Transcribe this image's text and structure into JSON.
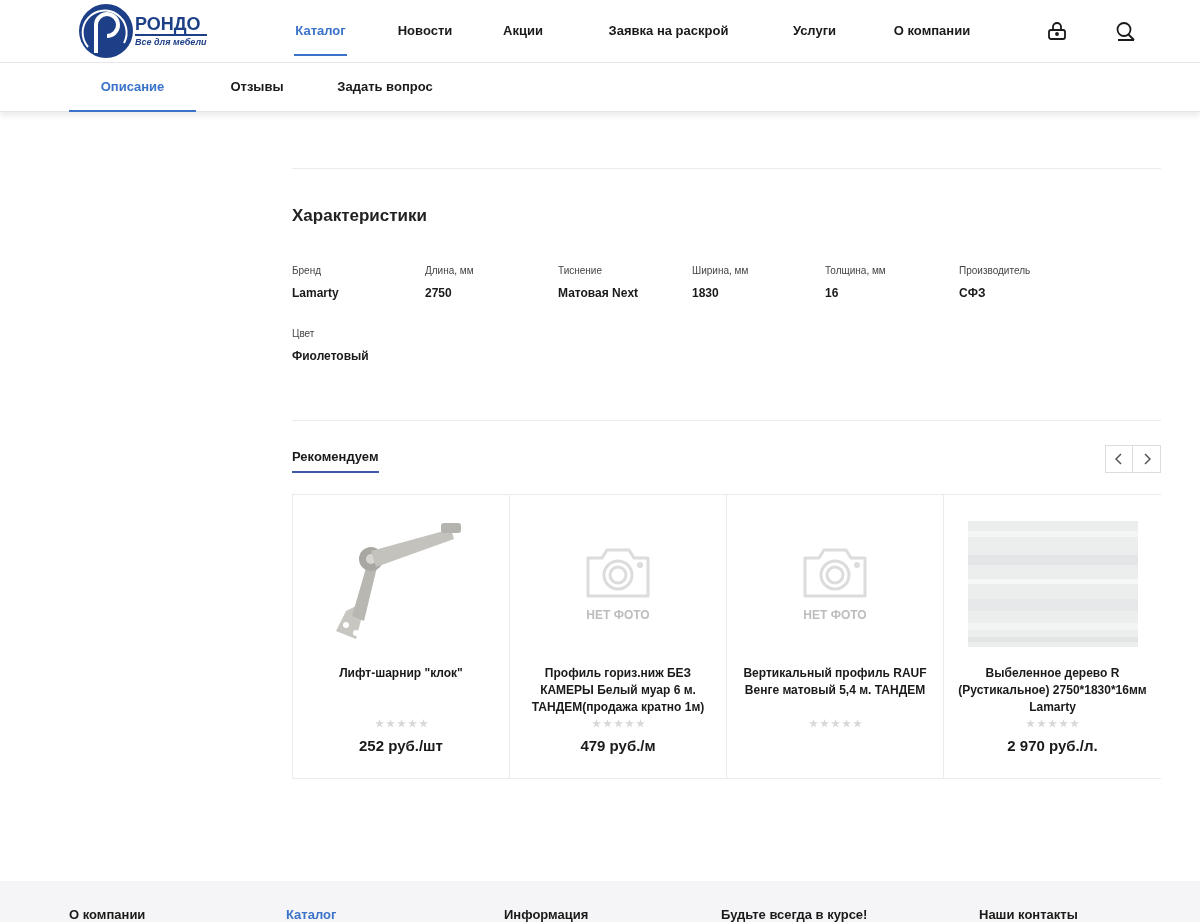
{
  "logo": {
    "name": "РОНДО",
    "tagline": "Все для мебели"
  },
  "nav": [
    {
      "label": "Каталог",
      "selected": true
    },
    {
      "label": "Новости",
      "selected": false
    },
    {
      "label": "Акции",
      "selected": false
    },
    {
      "label": "Заявка на раскрой",
      "selected": false
    },
    {
      "label": "Услуги",
      "selected": false
    },
    {
      "label": "О компании",
      "selected": false
    }
  ],
  "tabs": [
    {
      "label": "Описание",
      "selected": true
    },
    {
      "label": "Отзывы",
      "selected": false
    },
    {
      "label": "Задать вопрос",
      "selected": false
    }
  ],
  "specs": {
    "title": "Характеристики",
    "items": [
      {
        "label": "Бренд",
        "value": "Lamarty"
      },
      {
        "label": "Длина, мм",
        "value": "2750"
      },
      {
        "label": "Тиснение",
        "value": "Матовая Next"
      },
      {
        "label": "Ширина, мм",
        "value": "1830"
      },
      {
        "label": "Толщина, мм",
        "value": "16"
      },
      {
        "label": "Производитель",
        "value": "СФЗ"
      },
      {
        "label": "Цвет",
        "value": "Фиолетовый"
      }
    ]
  },
  "recommend": {
    "title": "Рекомендуем",
    "products": [
      {
        "name": "Лифт-шарнир \"клок\"",
        "stars": 0,
        "price": "252 руб./шт"
      },
      {
        "image": {
          "kind": "no_photo",
          "text": "НЕТ ФОТО"
        },
        "name": "Профиль гориз.ниж БЕЗ КАМЕРЫ Белый муар 6 м. ТАНДЕМ(продажа кратно 1м)",
        "stars": 0,
        "price": "479 руб./м"
      },
      {
        "image": {
          "kind": "no_photo",
          "text": "НЕТ ФОТО"
        },
        "name": "Вертикальный профиль RAUF Венге матовый 5,4 м. ТАНДЕМ",
        "stars": 0
      },
      {
        "image": {
          "kind": "wood"
        },
        "name": "Выбеленное дерево R (Рустикальное) 2750*1830*16мм Lamarty",
        "stars": 0,
        "price": "2 970 руб./л."
      }
    ]
  },
  "footer": {
    "columns": [
      {
        "title": "О компании",
        "selected": false
      },
      {
        "title": "Каталог",
        "selected": true
      },
      {
        "title": "Информация",
        "selected": false
      },
      {
        "title": "Будьте всегда в курсе!",
        "selected": false
      },
      {
        "title": "Наши контакты",
        "selected": false
      }
    ]
  }
}
